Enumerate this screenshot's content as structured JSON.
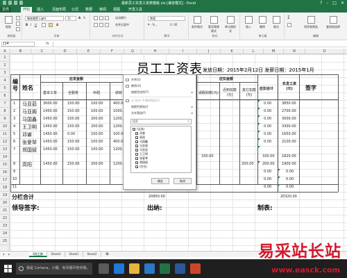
{
  "window": {
    "title": "最新员工实发工资表模板.xls [兼容模式] - Excel"
  },
  "ribbon_tabs": [
    {
      "label": "文件",
      "type": "file"
    },
    {
      "label": "开始",
      "type": "active"
    },
    {
      "label": "插入",
      "type": "normal"
    },
    {
      "label": "页面布局",
      "type": "normal"
    },
    {
      "label": "公式",
      "type": "normal"
    },
    {
      "label": "数据",
      "type": "normal"
    },
    {
      "label": "审阅",
      "type": "normal"
    },
    {
      "label": "视图",
      "type": "normal"
    },
    {
      "label": "开发工具",
      "type": "normal"
    }
  ],
  "ribbon": {
    "clipboard": {
      "label": "剪贴板",
      "paste": "粘贴"
    },
    "font": {
      "label": "字体",
      "name": "微软雅黑 Light",
      "size": "11"
    },
    "alignment": {
      "label": "对齐方式",
      "wrap": "自动换行",
      "merge": "合并后居中"
    },
    "number": {
      "label": "数字",
      "format": "常规"
    },
    "styles": {
      "label": "样式",
      "conditional": "条件格式",
      "table": "套用表格格式",
      "cell": "单元格样式"
    },
    "cells": {
      "label": "单元格",
      "insert": "插入",
      "delete": "删除",
      "format": "格式"
    },
    "editing": {
      "label": "编辑",
      "sort": "排序和筛选",
      "find": "查找和选择"
    }
  },
  "formula_bar": {
    "cell_ref": "J14",
    "fx": "fx",
    "content": ""
  },
  "grid": {
    "columns": [
      "A",
      "B",
      "C",
      "D",
      "E",
      "F",
      "G",
      "H",
      "I",
      "J",
      "K",
      "L",
      "M",
      "N",
      "O"
    ],
    "rows": [
      "1",
      "2",
      "3",
      "4",
      "5",
      "6",
      "7",
      "8",
      "9",
      "10",
      "11",
      "12",
      "13",
      "14",
      "15",
      "16",
      "17",
      "18",
      "19",
      "20",
      "21",
      "22",
      "23",
      "24",
      "25"
    ]
  },
  "sheet": {
    "title": "员工工资表",
    "issue_date": "发放日期：2015年2月12日 发薪日期：2015年1月",
    "headers": {
      "no": "编号",
      "name": "姓名",
      "payable": "应发金额",
      "deduct": "应扣金额",
      "base": "基本工资",
      "attendance": "全勤奖",
      "subsidy": "补助",
      "perf": "绩效",
      "late": "迟到扣款(元)",
      "other": "其它扣款(元)",
      "deduct_total": "应扣合计",
      "actual": "实发工资(元)",
      "sign": "签字",
      "leave": "请假扣款(元)"
    },
    "employees": [
      {
        "no": "1",
        "name": "马亚茹",
        "base": "3000.00",
        "attend": "150.00",
        "subsidy": "100.00",
        "perf": "400.00",
        "leave": "",
        "late": "",
        "other": "",
        "deduct": "0.00",
        "actual": "3850.00"
      },
      {
        "no": "2",
        "name": "马亚阁",
        "base": "1450.00",
        "attend": "150.00",
        "subsidy": "100.00",
        "perf": "1000.00",
        "leave": "",
        "late": "",
        "other": "",
        "deduct": "0.00",
        "actual": "2700.00"
      },
      {
        "no": "3",
        "name": "马国鑫",
        "base": "1450.00",
        "attend": "150.00",
        "subsidy": "200.00",
        "perf": "1200.00",
        "leave": "",
        "late": "",
        "other": "",
        "deduct": "0.00",
        "actual": "3000.00"
      },
      {
        "no": "4",
        "name": "王卫明",
        "base": "1450.00",
        "attend": "150.00",
        "subsidy": "200.00",
        "perf": "1200.00",
        "leave": "",
        "late": "",
        "other": "",
        "deduct": "0.00",
        "actual": "3300.00"
      },
      {
        "no": "5",
        "name": "邓睿",
        "base": "1450.00",
        "attend": "0.00",
        "subsidy": "100.00",
        "perf": "100.00",
        "leave": "",
        "late": "",
        "other": "",
        "deduct": "0.00",
        "actual": "1650.00"
      },
      {
        "no": "6",
        "name": "张爱琴",
        "base": "1450.00",
        "attend": "150.00",
        "subsidy": "100.00",
        "perf": "400.00",
        "leave": "",
        "late": "",
        "other": "",
        "deduct": "0.00",
        "actual": "2100.00"
      },
      {
        "no": "7",
        "name": "郑国斌",
        "base": "1450.00",
        "attend": "150.00",
        "subsidy": "100.00",
        "perf": "1200.00",
        "leave": "330.00",
        "late": "",
        "other": "",
        "deduct": "330.00",
        "actual": "1820.00"
      },
      {
        "no": "8",
        "name": "高阳",
        "base": "1450.00",
        "attend": "150.00",
        "subsidy": "200.00",
        "perf": "1200.00",
        "leave": "",
        "late": "",
        "other": "200.00",
        "deduct": "200.00",
        "actual": "1900.00"
      },
      {
        "no": "9",
        "name": "",
        "base": "",
        "attend": "",
        "subsidy": "",
        "perf": "",
        "leave": "",
        "late": "",
        "other": "",
        "deduct": "0.00",
        "actual": "0.00"
      },
      {
        "no": "10",
        "name": "",
        "base": "",
        "attend": "",
        "subsidy": "",
        "perf": "",
        "leave": "",
        "late": "",
        "other": "",
        "deduct": "0.00",
        "actual": "0.00"
      },
      {
        "no": "11",
        "name": "",
        "base": "",
        "attend": "",
        "subsidy": "",
        "perf": "",
        "leave": "",
        "late": "",
        "other": "",
        "deduct": "0.00",
        "actual": "0.00"
      }
    ],
    "total_label": "分栏合计",
    "total_values": {
      "perf": "20850.00",
      "actual": "20320.00"
    },
    "signatures": {
      "leader": "领导签字:",
      "cashier": "出纳:",
      "maker": "制表:"
    }
  },
  "filter_menu": {
    "items": [
      {
        "label": "升序(S)",
        "disabled": false,
        "arrow": false
      },
      {
        "label": "降序(O)",
        "disabled": false,
        "arrow": false
      },
      {
        "label": "按颜色排序(T)",
        "disabled": false,
        "arrow": true
      },
      {
        "label": "从\"姓名\"中清除筛选(C)",
        "disabled": true,
        "arrow": false
      },
      {
        "label": "按颜色筛选(I)",
        "disabled": false,
        "arrow": true
      },
      {
        "label": "文本筛选(F)",
        "disabled": false,
        "arrow": true
      }
    ],
    "search_placeholder": "搜索",
    "options": [
      {
        "label": "(全选)",
        "checked": true
      },
      {
        "label": "邓睿",
        "checked": true
      },
      {
        "label": "高阳",
        "checked": true
      },
      {
        "label": "马国鑫",
        "checked": true
      },
      {
        "label": "马亚阁",
        "checked": true
      },
      {
        "label": "马亚茹",
        "checked": true
      },
      {
        "label": "王卫明",
        "checked": true
      },
      {
        "label": "张爱琴",
        "checked": true
      },
      {
        "label": "郑国斌",
        "checked": true
      },
      {
        "label": "(空白)",
        "checked": true
      }
    ],
    "ok": "确定",
    "cancel": "取消"
  },
  "sheet_tabs": [
    {
      "label": "5月工资",
      "active": true
    },
    {
      "label": "Sheet3",
      "active": false
    },
    {
      "label": "Sheet1",
      "active": false
    },
    {
      "label": "Sheet2",
      "active": false
    }
  ],
  "taskbar": {
    "cortana_text": "我是 Cortana，小娜。有问题尽管问我。",
    "apps": [
      {
        "name": "task-view-icon",
        "color": "#5a5a5a"
      },
      {
        "name": "edge-icon",
        "color": "#1e78d6"
      },
      {
        "name": "explorer-icon",
        "color": "#e8b43c"
      },
      {
        "name": "store-icon",
        "color": "#2a78c8"
      },
      {
        "name": "excel-icon",
        "color": "#217346"
      },
      {
        "name": "word-icon",
        "color": "#2b5797"
      },
      {
        "name": "powerpoint-icon",
        "color": "#c8472a"
      }
    ]
  },
  "watermark": {
    "text": "易采站长站",
    "url": "www.easck.com",
    "color": "#d31a2c"
  },
  "colors": {
    "excel_green": "#217346"
  }
}
